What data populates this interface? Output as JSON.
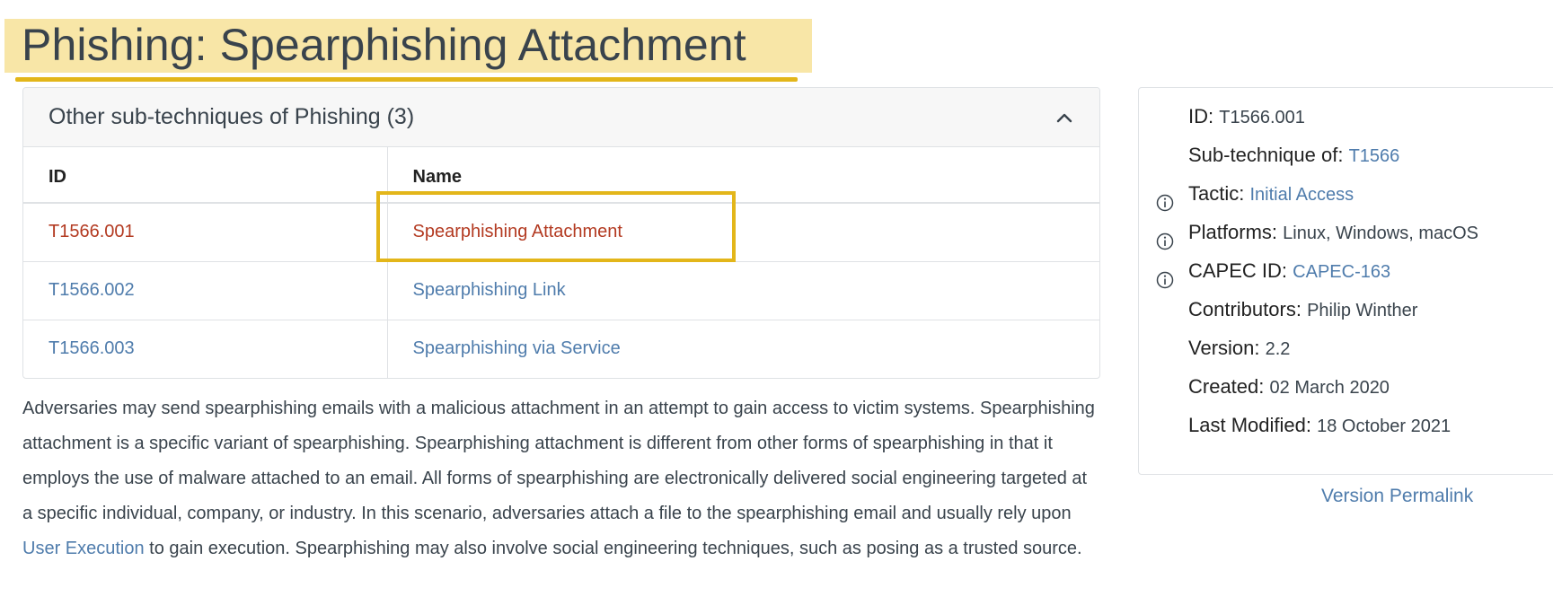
{
  "page": {
    "title": "Phishing: Spearphishing Attachment"
  },
  "subtechniques": {
    "header": "Other sub-techniques of Phishing (3)",
    "columns": [
      "ID",
      "Name"
    ],
    "rows": [
      {
        "id": "T1566.001",
        "name": "Spearphishing Attachment",
        "current": true
      },
      {
        "id": "T1566.002",
        "name": "Spearphishing Link",
        "current": false
      },
      {
        "id": "T1566.003",
        "name": "Spearphishing via Service",
        "current": false
      }
    ]
  },
  "description": {
    "before_link": "Adversaries may send spearphishing emails with a malicious attachment in an attempt to gain access to victim systems. Spearphishing attachment is a specific variant of spearphishing. Spearphishing attachment is different from other forms of spearphishing in that it employs the use of malware attached to an email. All forms of spearphishing are electronically delivered social engineering targeted at a specific individual, company, or industry. In this scenario, adversaries attach a file to the spearphishing email and usually rely upon ",
    "link": "User Execution",
    "after_link": " to gain execution. Spearphishing may also involve social engineering techniques, such as posing as a trusted source."
  },
  "info": {
    "id_label": "ID:",
    "id_value": "T1566.001",
    "subtechnique_of_label": "Sub-technique of:",
    "subtechnique_of_value": "T1566",
    "tactic_label": "Tactic:",
    "tactic_value": "Initial Access",
    "platforms_label": "Platforms:",
    "platforms_value": "Linux, Windows, macOS",
    "capec_label": "CAPEC ID:",
    "capec_value": "CAPEC-163",
    "contributors_label": "Contributors:",
    "contributors_value": "Philip Winther",
    "version_label": "Version:",
    "version_value": "2.2",
    "created_label": "Created:",
    "created_value": "02 March 2020",
    "modified_label": "Last Modified:",
    "modified_value": "18 October 2021"
  },
  "permalink": "Version Permalink",
  "colors": {
    "link": "#4f7cac",
    "current_link": "#b33a21",
    "highlight": "#f8e6a7",
    "highlight_border": "#e3b61a"
  },
  "icons": {
    "collapse": "chevron-up-icon",
    "info": "info-circle-icon"
  }
}
